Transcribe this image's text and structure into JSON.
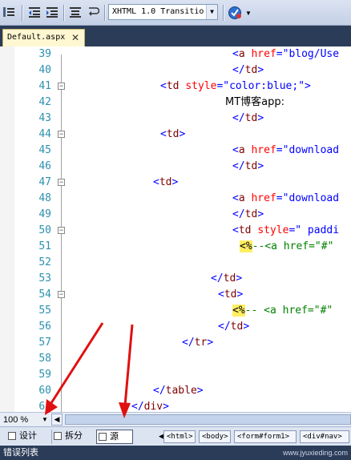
{
  "toolbar": {
    "doctype_value": "XHTML 1.0 Transitio"
  },
  "tab": {
    "label": "Default.aspx",
    "close": "✕"
  },
  "editor": {
    "lines": [
      {
        "n": "39",
        "text": "<a href=\"blog/Use"
      },
      {
        "n": "40",
        "text": "</td>"
      },
      {
        "n": "41",
        "text": "<td style=\"color:blue;\">"
      },
      {
        "n": "42",
        "text": "MT博客app:"
      },
      {
        "n": "43",
        "text": "</td>"
      },
      {
        "n": "44",
        "text": "<td>"
      },
      {
        "n": "45",
        "text": "<a href=\"download"
      },
      {
        "n": "46",
        "text": "</td>"
      },
      {
        "n": "47",
        "text": "<td>"
      },
      {
        "n": "48",
        "text": "<a href=\"download"
      },
      {
        "n": "49",
        "text": "</td>"
      },
      {
        "n": "50",
        "text": "<td style=\" paddi"
      },
      {
        "n": "51",
        "text": "<%--<a href=\"#\""
      },
      {
        "n": "52",
        "text": ""
      },
      {
        "n": "53",
        "text": "</td>"
      },
      {
        "n": "54",
        "text": "<td>"
      },
      {
        "n": "55",
        "text": "<%-- <a href=\"#\""
      },
      {
        "n": "56",
        "text": "</td>"
      },
      {
        "n": "57",
        "text": "</tr>"
      },
      {
        "n": "58",
        "text": ""
      },
      {
        "n": "59",
        "text": ""
      },
      {
        "n": "60",
        "text": "</table>"
      },
      {
        "n": "61",
        "text": "</div>"
      }
    ]
  },
  "statusbar": {
    "zoom": "100 %",
    "views": {
      "design": "设计",
      "split": "拆分",
      "source": "源"
    },
    "breadcrumbs": [
      "<html>",
      "<body>",
      "<form#form1>",
      "<div#nav>"
    ]
  },
  "error_list": {
    "label": "错误列表"
  },
  "watermark": "www.jyuxieding.com"
}
